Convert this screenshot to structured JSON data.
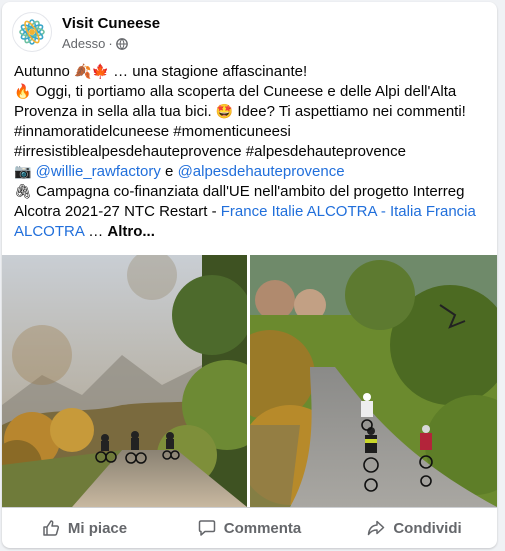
{
  "post": {
    "page_name": "Visit Cuneese",
    "timestamp": "Adesso",
    "separator": "·",
    "privacy_icon": "globe-icon",
    "text": {
      "line1_a": "Autunno ",
      "line1_emoji": "🍂🍁",
      "line1_b": " … una stagione affascinante!",
      "line2_emoji": "🔥",
      "line2": " Oggi, ti portiamo alla scoperta del Cuneese e delle Alpi dell'Alta Provenza in sella alla tua bici. ",
      "line2_emoji2": "🤩",
      "line2_b": " Idee? Ti aspettiamo nei commenti!",
      "hashtags1": "#innamoratidelcuneese #momenticuneesi",
      "hashtags2": "#irresistiblealpesdehauteprovence #alpesdehauteprovence",
      "camera_emoji": "📷",
      "mention1": "@willie_rawfactory",
      "mention_join": " e ",
      "mention2": "@alpesdehauteprovence",
      "clip_emoji": "🖇",
      "campaign": " Campagna co-finanziata dall'UE nell'ambito del progetto Interreg Alcotra 2021-27 NTC Restart - ",
      "campaign_link": "France Italie ALCOTRA - Italia Francia ALCOTRA",
      "ellipsis": " … ",
      "more": "Altro..."
    }
  },
  "actions": {
    "like": "Mi piace",
    "comment": "Commenta",
    "share": "Condividi"
  },
  "colors": {
    "link": "#216fdb",
    "secondary_text": "#65676b",
    "brand_logo": "#3aa6c9"
  }
}
